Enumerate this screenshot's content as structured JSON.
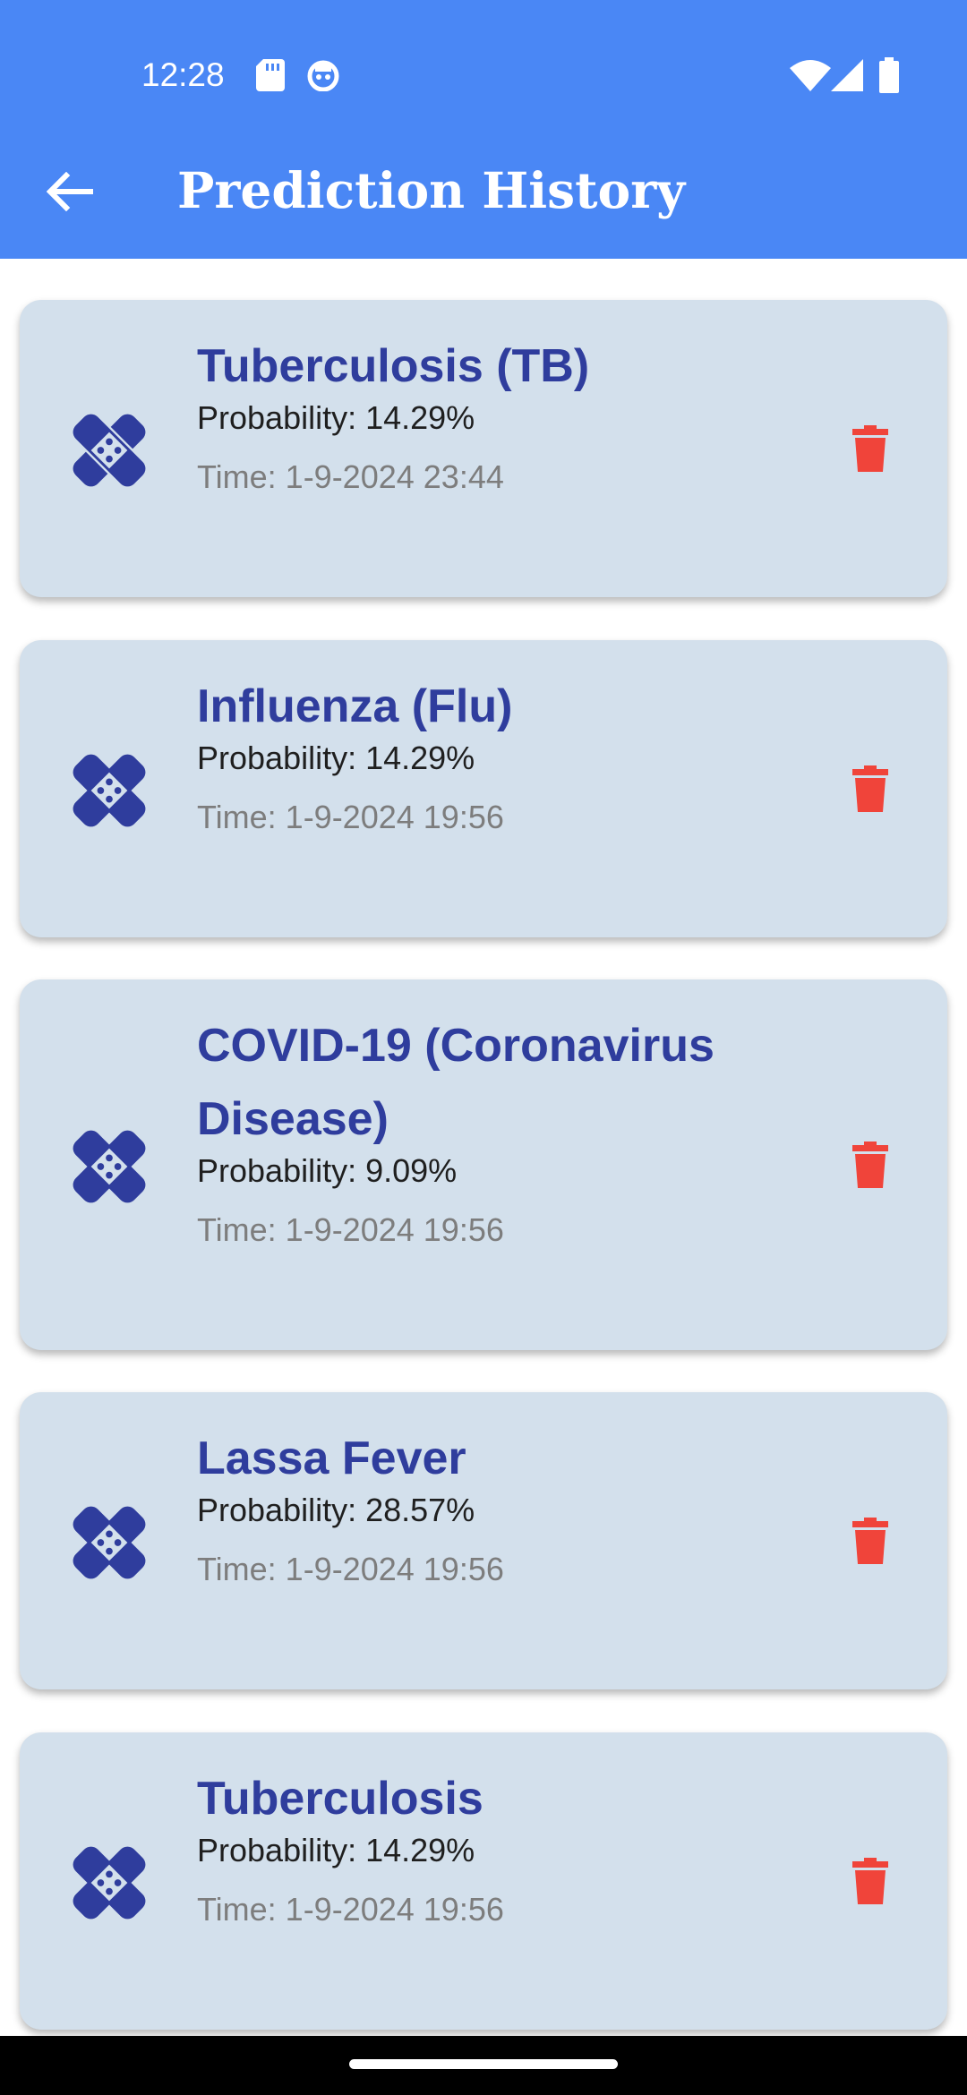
{
  "status_bar": {
    "time": "12:28"
  },
  "app_bar": {
    "title": "Prediction History"
  },
  "icons": {
    "back": "arrow-left-icon",
    "item": "bandage-icon",
    "delete": "trash-icon"
  },
  "colors": {
    "app_bar": "#4a87f5",
    "card_bg": "#d3e0ec",
    "title_text": "#2f3d9d",
    "delete": "#f0443a"
  },
  "history": [
    {
      "title": "Tuberculosis (TB)",
      "probability": "Probability: 14.29%",
      "time": "Time: 1-9-2024 23:44"
    },
    {
      "title": "Influenza (Flu)",
      "probability": "Probability: 14.29%",
      "time": "Time: 1-9-2024 19:56"
    },
    {
      "title": "COVID-19 (Coronavirus Disease)",
      "probability": "Probability: 9.09%",
      "time": "Time: 1-9-2024 19:56"
    },
    {
      "title": "Lassa Fever",
      "probability": "Probability: 28.57%",
      "time": "Time: 1-9-2024 19:56"
    },
    {
      "title": "Tuberculosis",
      "probability": "Probability: 14.29%",
      "time": "Time: 1-9-2024 19:56"
    }
  ]
}
